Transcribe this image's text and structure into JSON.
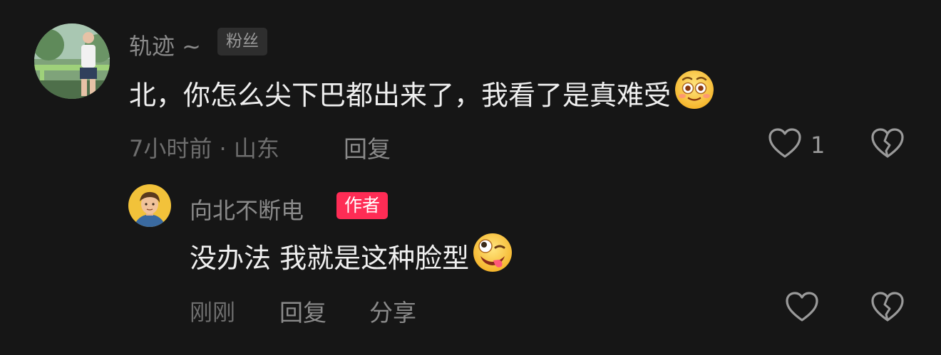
{
  "comments": [
    {
      "username": "轨迹 ~",
      "badge": "粉丝",
      "text": "北，你怎么尖下巴都出来了，我看了是真难受",
      "emoji_icon": "flushed-face-icon",
      "time_location": "7小时前 · 山东",
      "reply_label": "回复",
      "like_count": "1",
      "like_icon": "heart-outline-icon",
      "dislike_icon": "broken-heart-icon"
    },
    {
      "username": "向北不断电",
      "badge": "作者",
      "text": "没办法 我就是这种脸型",
      "emoji_icon": "zany-face-icon",
      "time": "刚刚",
      "reply_label": "回复",
      "share_label": "分享",
      "like_icon": "heart-outline-icon",
      "dislike_icon": "broken-heart-icon"
    }
  ],
  "colors": {
    "background": "#161616",
    "author_badge": "#fe2c55",
    "body_text": "#efefef",
    "meta_text": "#6e6e6e"
  }
}
